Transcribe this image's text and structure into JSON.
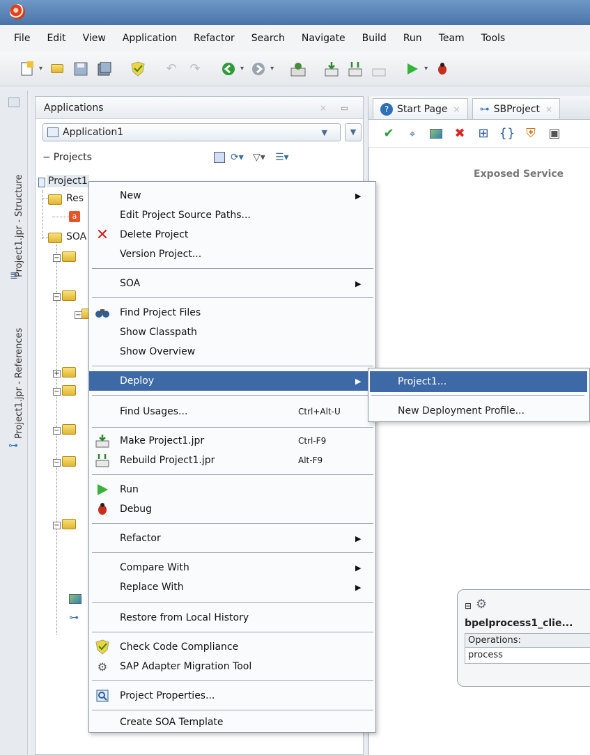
{
  "menubar": {
    "items": [
      "File",
      "Edit",
      "View",
      "Application",
      "Refactor",
      "Search",
      "Navigate",
      "Build",
      "Run",
      "Team",
      "Tools"
    ]
  },
  "side_tabs": {
    "structure": "Project1.jpr - Structure",
    "references": "Project1.jpr - References"
  },
  "applications_panel": {
    "title": "Applications",
    "application_name": "Application1",
    "projects_label": "Projects",
    "project_name": "Project1",
    "tree_partial_labels": [
      "Res",
      "SOA"
    ]
  },
  "editor": {
    "tabs": [
      "Start Page",
      "SBProject"
    ],
    "exposed_services_label": "Exposed Service",
    "component": {
      "name": "bpelprocess1_clie...",
      "operations_header": "Operations:",
      "operations": [
        "process"
      ]
    }
  },
  "context_menu": {
    "items": [
      {
        "label": "New",
        "submenu": true
      },
      {
        "label": "Edit Project Source Paths..."
      },
      {
        "label": "Delete Project",
        "icon": "delete-x-icon"
      },
      {
        "label": "Version Project..."
      },
      {
        "label": "SOA",
        "submenu": true
      },
      {
        "label": "Find Project Files",
        "icon": "binoculars-icon"
      },
      {
        "label": "Show Classpath"
      },
      {
        "label": "Show Overview"
      },
      {
        "label": "Deploy",
        "submenu": true,
        "highlighted": true
      },
      {
        "label": "Find Usages...",
        "shortcut": "Ctrl+Alt-U"
      },
      {
        "label": "Make Project1.jpr",
        "shortcut": "Ctrl-F9",
        "icon": "make-icon"
      },
      {
        "label": "Rebuild Project1.jpr",
        "shortcut": "Alt-F9",
        "icon": "rebuild-icon"
      },
      {
        "label": "Run",
        "icon": "run-icon"
      },
      {
        "label": "Debug",
        "icon": "debug-icon"
      },
      {
        "label": "Refactor",
        "submenu": true
      },
      {
        "label": "Compare With",
        "submenu": true
      },
      {
        "label": "Replace With",
        "submenu": true
      },
      {
        "label": "Restore from Local History"
      },
      {
        "label": "Check Code Compliance",
        "icon": "compliance-shield-icon"
      },
      {
        "label": "SAP Adapter Migration Tool",
        "icon": "sap-migration-icon"
      },
      {
        "label": "Project Properties...",
        "icon": "properties-icon"
      },
      {
        "label": "Create SOA Template"
      }
    ]
  },
  "deploy_submenu": {
    "items": [
      {
        "label": "Project1...",
        "highlighted": true
      },
      {
        "label": "New Deployment Profile..."
      }
    ]
  },
  "colors": {
    "titlebar": "#4a74a9",
    "highlight": "#3d6aa6",
    "menu_bg": "#fafbfc"
  }
}
